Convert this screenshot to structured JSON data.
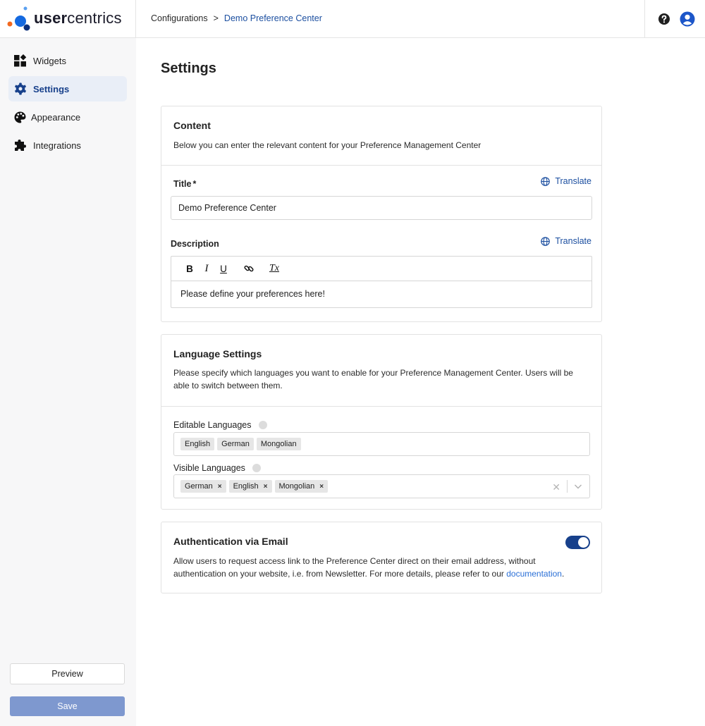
{
  "brand": {
    "logo_text_bold": "user",
    "logo_text_rest": "centrics"
  },
  "breadcrumb": {
    "parent": "Configurations",
    "separator": ">",
    "current": "Demo Preference Center"
  },
  "header_icons": {
    "help": "help-icon",
    "user": "user-avatar-icon"
  },
  "sidebar": {
    "items": [
      {
        "label": "Widgets",
        "icon": "widgets-icon"
      },
      {
        "label": "Settings",
        "icon": "gear-icon",
        "active": true
      },
      {
        "label": "Appearance",
        "icon": "palette-icon"
      },
      {
        "label": "Integrations",
        "icon": "puzzle-icon"
      }
    ],
    "preview_label": "Preview",
    "save_label": "Save"
  },
  "page": {
    "title": "Settings"
  },
  "content_card": {
    "title": "Content",
    "description": "Below you can enter the relevant content for your Preference Management Center",
    "title_label": "Title",
    "required_mark": "*",
    "translate_label": "Translate",
    "title_value": "Demo Preference Center",
    "description_label": "Description",
    "editor_toolbar": [
      "B",
      "I",
      "U",
      "link",
      "Tx"
    ],
    "description_value": "Please define your preferences here!"
  },
  "language_card": {
    "title": "Language Settings",
    "description": "Please specify which languages you want to enable for your Preference Management Center. Users will be able to switch between them.",
    "editable_label": "Editable Languages",
    "editable_languages": [
      "English",
      "German",
      "Mongolian"
    ],
    "visible_label": "Visible Languages",
    "visible_languages": [
      "German",
      "English",
      "Mongolian"
    ],
    "remove_mark": "×",
    "clear_mark": "✕"
  },
  "auth_card": {
    "title": "Authentication via Email",
    "toggle_on": true,
    "description_before_link": "Allow users to request access link to the Preference Center direct on their email address, without authentication on your website, i.e. from Newsletter. For more details, please refer to our ",
    "link_text": "documentation",
    "description_after_link": "."
  },
  "colors": {
    "accent": "#17408b",
    "link": "#2a6fd6",
    "save_button": "#7e98cf",
    "sidebar_bg": "#f7f7f8"
  }
}
